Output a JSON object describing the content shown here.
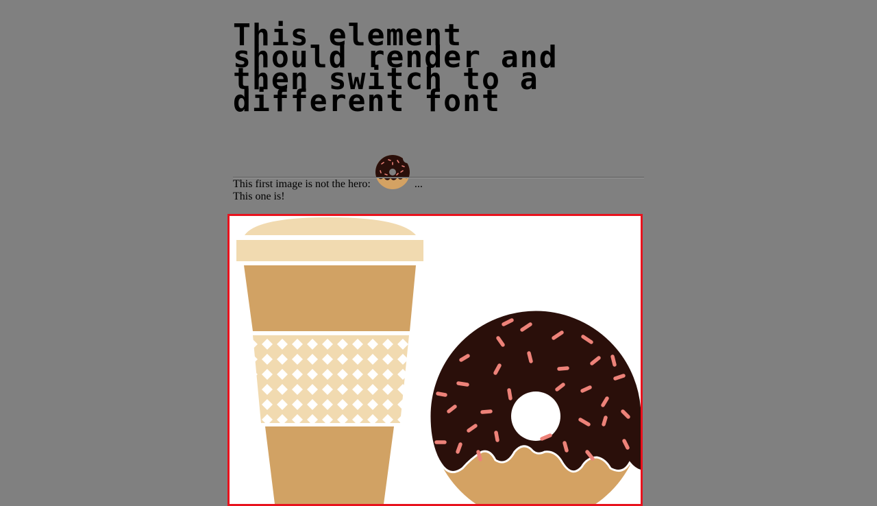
{
  "heading": {
    "line1": "This element",
    "line2": "should render and",
    "line3": "then switch to a",
    "line4": "different font"
  },
  "first_image": {
    "text_before": "This first image is not the hero:",
    "text_after": "...",
    "icon": "donut-icon"
  },
  "second_paragraph": {
    "text": "This one is!"
  },
  "hero": {
    "icon": "coffee-and-donut-illustration",
    "border_color": "#e8121d"
  },
  "colors": {
    "page_background": "#808080",
    "coffee_cup": "#d1a264",
    "cup_lid": "#f1dab0",
    "donut_chocolate": "#2a0f0a",
    "donut_dough": "#d4a263",
    "sprinkles": "#ed8279"
  }
}
